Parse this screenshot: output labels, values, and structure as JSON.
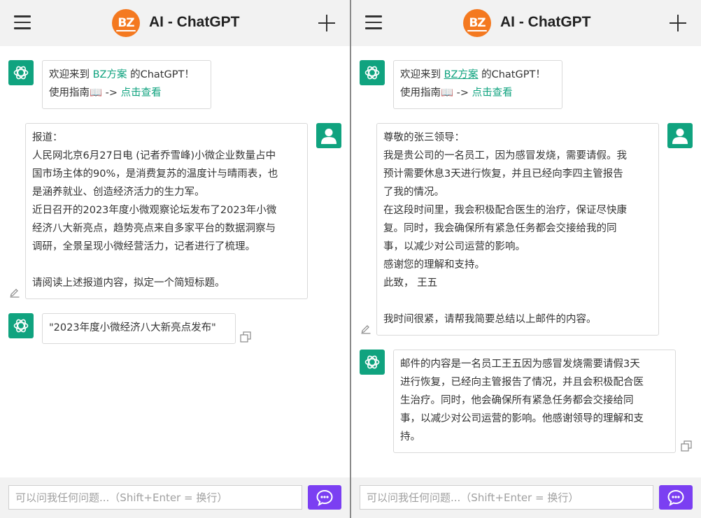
{
  "app": {
    "title": "AI - ChatGPT",
    "logo_text": "BZ"
  },
  "colors": {
    "accent": "#10a37f",
    "send": "#7b3ff2",
    "logo": "#f47920"
  },
  "left": {
    "welcome": {
      "prefix": "欢迎来到 ",
      "brand": "BZ方案",
      "suffix": " 的ChatGPT！",
      "guide_prefix": "使用指南📖 -> ",
      "guide_link": "点击查看"
    },
    "user_message": [
      "报道：",
      "人民网北京6月27日电 (记者乔雪峰)小微企业数量占中",
      "国市场主体的90%，是消费复苏的温度计与晴雨表，也",
      "是涵养就业、创造经济活力的生力军。",
      "近日召开的2023年度小微观察论坛发布了2023年小微",
      "经济八大新亮点，趋势亮点来自多家平台的数据洞察与",
      "调研，全景呈现小微经营活力，记者进行了梳理。",
      "",
      "请阅读上述报道内容，拟定一个简短标题。"
    ],
    "bot_reply": [
      "\"2023年度小微经济八大新亮点发布\""
    ]
  },
  "right": {
    "welcome": {
      "prefix": "欢迎来到 ",
      "brand": "BZ方案",
      "suffix": " 的ChatGPT！",
      "guide_prefix": "使用指南📖 -> ",
      "guide_link": "点击查看"
    },
    "user_message": [
      "尊敬的张三领导：",
      "我是贵公司的一名员工，因为感冒发烧，需要请假。我",
      "预计需要休息3天进行恢复，并且已经向李四主管报告",
      "了我的情况。",
      "在这段时间里，我会积极配合医生的治疗，保证尽快康",
      "复。同时，我会确保所有紧急任务都会交接给我的同",
      "事，以减少对公司运营的影响。",
      "感谢您的理解和支持。",
      "此致，  王五",
      "",
      "我时间很紧，请帮我简要总结以上邮件的内容。"
    ],
    "bot_reply": [
      "邮件的内容是一名员工王五因为感冒发烧需要请假3天",
      "进行恢复，已经向主管报告了情况，并且会积极配合医",
      "生治疗。同时，他会确保所有紧急任务都会交接给同",
      "事，以减少对公司运营的影响。他感谢领导的理解和支",
      "持。"
    ]
  },
  "composer": {
    "placeholder": "可以问我任何问题...（Shift+Enter = 换行）"
  }
}
